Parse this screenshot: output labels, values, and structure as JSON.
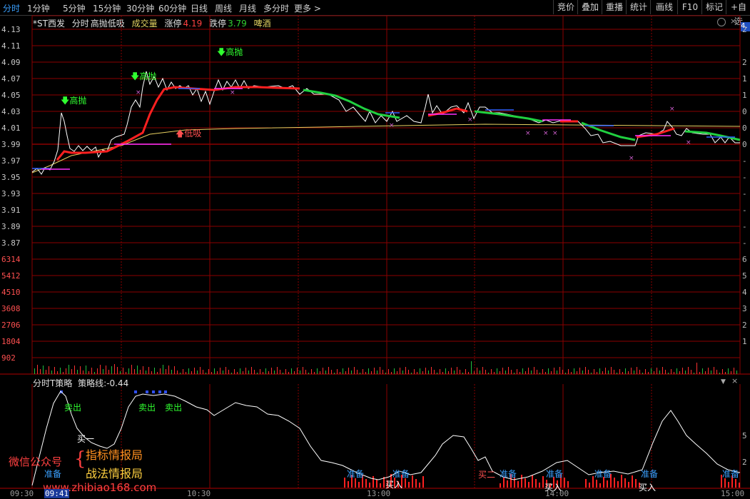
{
  "toolbar": {
    "periods": [
      "分时",
      "1分钟",
      "5分钟",
      "15分钟",
      "30分钟",
      "60分钟",
      "日线",
      "周线",
      "月线",
      "多分时",
      "更多 >"
    ],
    "active_period": "分时",
    "right_buttons": [
      "竞价",
      "叠加",
      "重播",
      "统计",
      "画线",
      "F10",
      "标记",
      "+自选"
    ]
  },
  "stock": {
    "name": "*ST西发",
    "view": "分时",
    "indicator": "高抛低吸",
    "vol_label": "成交量",
    "limit_up_label": "涨停",
    "limit_up": "4.19",
    "limit_down_label": "跌停",
    "limit_down": "3.79",
    "sector": "啤酒",
    "right_price": "4."
  },
  "price_axis": {
    "labels": [
      "4.13",
      "4.11",
      "4.09",
      "4.07",
      "4.05",
      "4.03",
      "4.01",
      "3.99",
      "3.97",
      "3.95",
      "3.93",
      "3.91",
      "3.89",
      "3.87"
    ],
    "colors": [
      "red",
      "red",
      "red",
      "red",
      "red",
      "red",
      "red",
      "green",
      "green",
      "green",
      "green",
      "green",
      "green",
      "green"
    ],
    "right_labels": [
      "2",
      "2",
      "1",
      "1",
      "1",
      "0",
      "0",
      "0",
      "-",
      "-",
      "-",
      "-",
      "-",
      "-"
    ]
  },
  "volume_axis": {
    "labels": [
      "6314",
      "5412",
      "4510",
      "3608",
      "2706",
      "1804",
      "902"
    ],
    "right_labels": [
      "6",
      "5",
      "4",
      "3",
      "2",
      "1"
    ]
  },
  "lower_panel": {
    "title": "分时T策略",
    "line_label": "策略线:",
    "line_value": "-0.44",
    "right_labels": [
      "5",
      "2"
    ]
  },
  "signals": {
    "high_sell_1": "高抛",
    "high_sell_2": "高抛",
    "high_sell_3": "高抛",
    "low_buy": "低吸",
    "sell_1": "卖出",
    "sell_2": "卖出",
    "sell_3": "卖出",
    "buy_1": "买一",
    "buy_2": "买二",
    "prep": "准备",
    "buy_in": "买入"
  },
  "time_axis": {
    "labels": [
      "09:30",
      "10:30",
      "13:00",
      "14:00",
      "15:00"
    ],
    "cursor_time": "09:41"
  },
  "watermark": {
    "line1": "微信公众号",
    "line2a": "指标情报局",
    "line2b": "战法情报局",
    "url": "www.zhibiao168.com"
  },
  "colors": {
    "price_line": "#ffffff",
    "avg_line": "#e8d060",
    "strategy_up": "#ff2020",
    "strategy_down": "#20d040",
    "grid": "#8b0000",
    "volume_up": "#ff3030",
    "volume_down": "#20c040"
  }
}
